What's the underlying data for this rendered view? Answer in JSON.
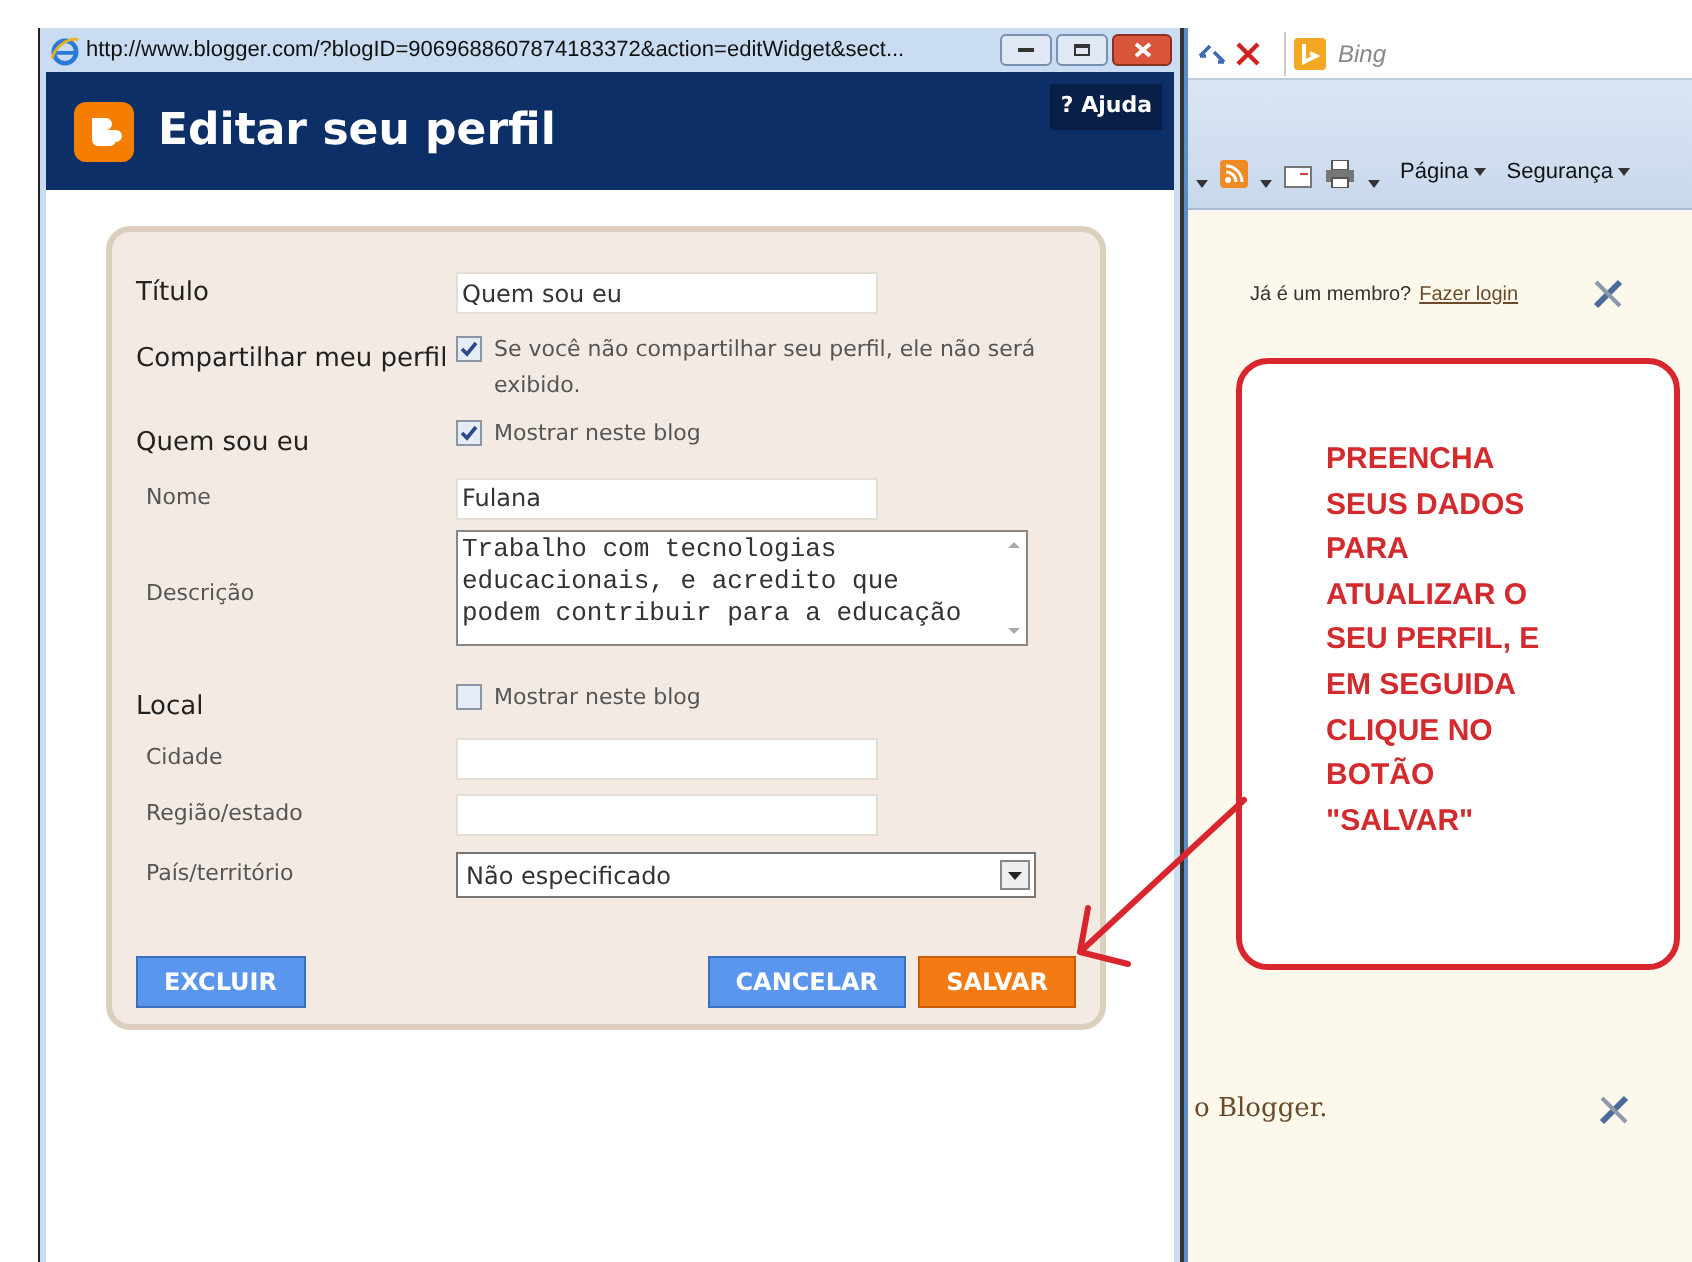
{
  "popup": {
    "title": "http://www.blogger.com/?blogID=9069688607874183372&action=editWidget&sect...",
    "header": "Editar seu perfil",
    "help": "? Ajuda",
    "rows": [
      {
        "kind": "text",
        "label": "Título",
        "heading": true,
        "value": "Quem sou eu"
      },
      {
        "kind": "checkbox",
        "label": "Compartilhar meu perfil",
        "heading": true,
        "checked": true,
        "text": "Se você não compartilhar seu perfil, ele não será exibido."
      },
      {
        "kind": "checkbox",
        "label": "Quem sou eu",
        "heading": true,
        "checked": true,
        "text": "Mostrar neste blog"
      },
      {
        "kind": "text",
        "label": "Nome",
        "heading": false,
        "value": "Fulana"
      },
      {
        "kind": "textarea",
        "label": "Descrição",
        "heading": false,
        "value": "Trabalho com tecnologias educacionais, e acredito que podem contribuir para a educação"
      },
      {
        "kind": "checkbox",
        "label": "Local",
        "heading": true,
        "checked": false,
        "text": "Mostrar neste blog"
      },
      {
        "kind": "text",
        "label": "Cidade",
        "heading": false
      },
      {
        "kind": "text",
        "label": "Região/estado",
        "heading": false
      },
      {
        "kind": "select",
        "label": "País/território",
        "heading": false,
        "value": "Não especificado"
      }
    ],
    "buttons": [
      {
        "label": "EXCLUIR",
        "kind": "normal"
      },
      {
        "label": "CANCELAR",
        "kind": "normal"
      },
      {
        "label": "SALVAR",
        "kind": "save"
      }
    ]
  },
  "browser": {
    "search_placeholder": "Bing",
    "commands": [
      "Página",
      "Segurança"
    ],
    "member_text": "Já é um membro?",
    "login_link": "Fazer login",
    "footer_text": "o Blogger."
  },
  "callout": {
    "text": "PREENCHA SEUS DADOS PARA ATUALIZAR O SEU PERFIL, E EM SEGUIDA CLIQUE NO BOTÃO \"SALVAR\""
  }
}
